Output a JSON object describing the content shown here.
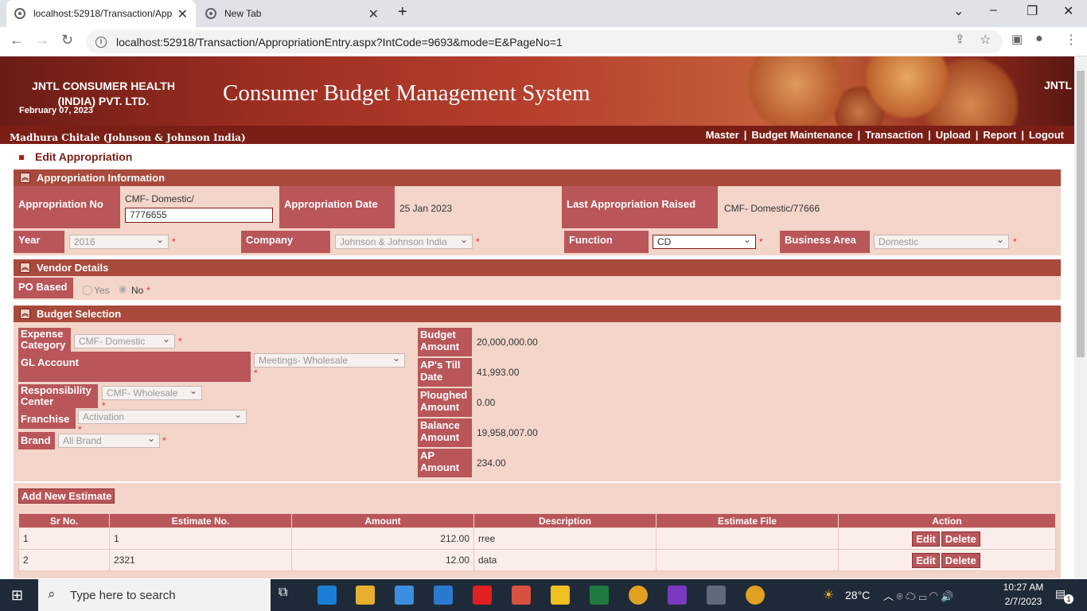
{
  "browser": {
    "tabs": [
      {
        "title": "localhost:52918/Transaction/App"
      },
      {
        "title": "New Tab"
      }
    ],
    "url": "localhost:52918/Transaction/AppropriationEntry.aspx?IntCode=9693&mode=E&PageNo=1"
  },
  "header": {
    "company": "JNTL CONSUMER HEALTH (INDIA) PVT. LTD.",
    "date": "February 07, 2023",
    "title": "Consumer Budget Management System",
    "company_right": "JNTL"
  },
  "userbar": {
    "user": "Madhura Chitale (Johnson & Johnson India)",
    "menu": [
      "Master",
      "|",
      "Budget Maintenance",
      "|",
      "Transaction",
      "|",
      "Upload",
      "|",
      "Report",
      "|",
      "Logout"
    ]
  },
  "page_title": "Edit Appropriation",
  "appropriation": {
    "section": "Appropriation Information",
    "no_label": "Appropriation No",
    "no_prefix": "CMF- Domestic/",
    "no_value": "7776655",
    "date_label": "Appropriation Date",
    "date_value": "25 Jan 2023",
    "last_label": "Last Appropriation Raised",
    "last_value": "CMF- Domestic/77666",
    "year_label": "Year",
    "year_value": "2016",
    "company_label": "Company",
    "company_value": "Johnson & Johnson India",
    "function_label": "Function",
    "function_value": "CD",
    "ba_label": "Business Area",
    "ba_value": "Domestic"
  },
  "vendor": {
    "section": "Vendor Details",
    "po_label": "PO Based",
    "yes": "Yes",
    "no": "No"
  },
  "budget": {
    "section": "Budget Selection",
    "expense_label": "Expense Category",
    "expense_value": "CMF- Domestic",
    "gl_label": "GL Account",
    "gl_value": "Meetings- Wholesale",
    "resp_label": "Responsibility Center",
    "resp_value": "CMF- Wholesale",
    "franchise_label": "Franchise",
    "franchise_value": "Activation",
    "brand_label": "Brand",
    "brand_value": "All Brand",
    "budget_amount_label": "Budget Amount",
    "budget_amount": "20,000,000.00",
    "ap_till_label": "AP's Till Date",
    "ap_till": "41,993.00",
    "ploughed_label": "Ploughed Amount",
    "ploughed": "0.00",
    "balance_label": "Balance Amount",
    "balance": "19,958,007.00",
    "ap_amount_label": "AP Amount",
    "ap_amount": "234.00"
  },
  "estimates": {
    "add_button": "Add New Estimate",
    "columns": [
      "Sr No.",
      "Estimate No.",
      "Amount",
      "Description",
      "Estimate File",
      "Action"
    ],
    "rows": [
      {
        "sr": "1",
        "no": "1",
        "amount": "212.00",
        "desc": "rree"
      },
      {
        "sr": "2",
        "no": "2321",
        "amount": "12.00",
        "desc": "data"
      }
    ],
    "edit": "Edit",
    "delete": "Delete"
  },
  "taskbar": {
    "search": "Type here to search",
    "weather": "28°C",
    "time": "10:27 AM",
    "date": "2/7/2023",
    "notif": "1"
  }
}
